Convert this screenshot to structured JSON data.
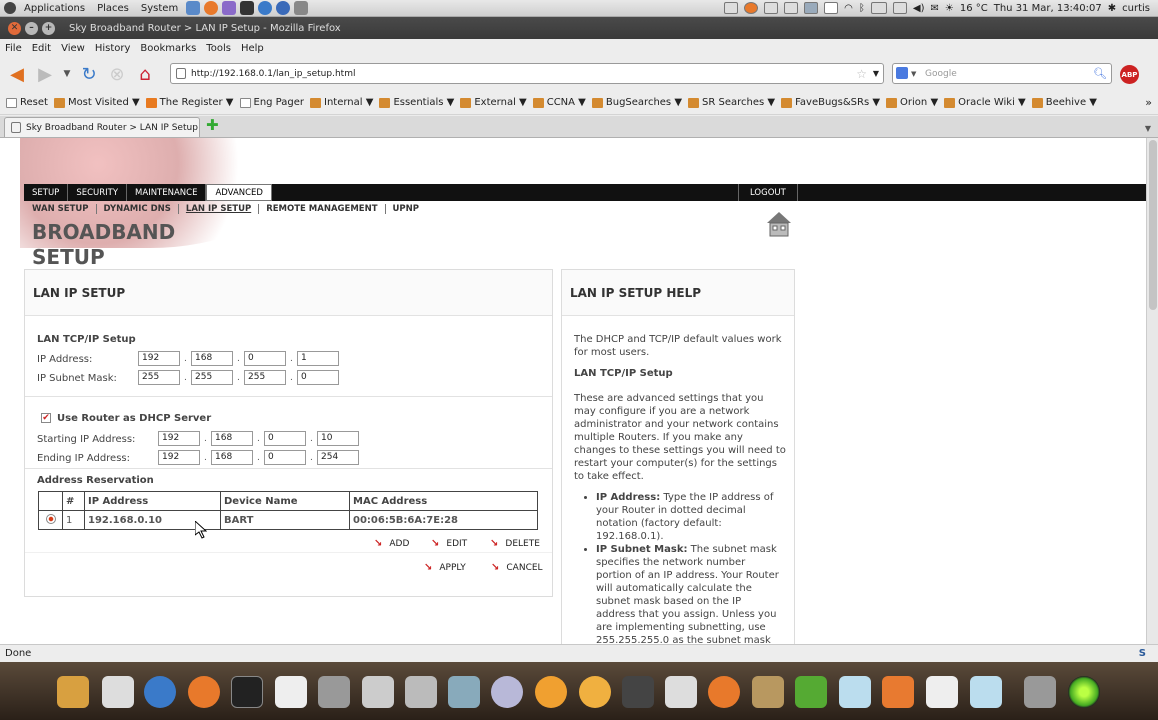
{
  "panel": {
    "menus": [
      "Applications",
      "Places",
      "System"
    ],
    "temperature": "16 °C",
    "datetime": "Thu 31 Mar, 13:40:07",
    "user": "curtis"
  },
  "window": {
    "title": "Sky Broadband Router > LAN IP Setup - Mozilla Firefox"
  },
  "menubar": [
    "File",
    "Edit",
    "View",
    "History",
    "Bookmarks",
    "Tools",
    "Help"
  ],
  "nav": {
    "url": "http://192.168.0.1/lan_ip_setup.html",
    "search_placeholder": "Google",
    "abp": "ABP"
  },
  "bookmarks": [
    "Reset",
    "Most Visited ▼",
    "The Register ▼",
    "Eng Pager",
    "Internal ▼",
    "Essentials ▼",
    "External ▼",
    "CCNA ▼",
    "BugSearches ▼",
    "SR Searches ▼",
    "FaveBugs&SRs ▼",
    "Orion ▼",
    "Oracle Wiki ▼",
    "Beehive ▼"
  ],
  "tab": {
    "label": "Sky Broadband Router > LAN IP Setup"
  },
  "router": {
    "mainnav": [
      "SETUP",
      "SECURITY",
      "MAINTENANCE",
      "ADVANCED"
    ],
    "logout": "LOGOUT",
    "subnav": [
      "WAN SETUP",
      "DYNAMIC DNS",
      "LAN IP SETUP",
      "REMOTE MANAGEMENT",
      "UPNP"
    ],
    "title_line1": "BROADBAND",
    "title_line2": "SETUP",
    "lan": {
      "heading": "LAN IP SETUP",
      "tcpip_title": "LAN TCP/IP Setup",
      "ip_label": "IP Address:",
      "ip": [
        "192",
        "168",
        "0",
        "1"
      ],
      "mask_label": "IP Subnet Mask:",
      "mask": [
        "255",
        "255",
        "255",
        "0"
      ],
      "dhcp_label": "Use Router as DHCP Server",
      "start_label": "Starting IP Address:",
      "start": [
        "192",
        "168",
        "0",
        "10"
      ],
      "end_label": "Ending IP Address:",
      "end": [
        "192",
        "168",
        "0",
        "254"
      ],
      "reservation_title": "Address Reservation",
      "columns": [
        "#",
        "IP Address",
        "Device Name",
        "MAC Address"
      ],
      "rows": [
        {
          "num": "1",
          "ip": "192.168.0.10",
          "device": "BART",
          "mac": "00:06:5B:6A:7E:28"
        }
      ],
      "add": "ADD",
      "edit": "EDIT",
      "delete": "DELETE",
      "apply": "APPLY",
      "cancel": "CANCEL"
    },
    "help": {
      "heading": "LAN IP SETUP HELP",
      "intro": "The DHCP and TCP/IP default values work for most users.",
      "sub": "LAN TCP/IP Setup",
      "para": "These are advanced settings that you may configure if you are a network administrator and your network contains multiple Routers. If you make any changes to these settings you will need to restart your computer(s) for the settings to take effect.",
      "b1_term": "IP Address:",
      "b1_text": "Type the IP address of your Router in dotted decimal notation (factory default: 192.168.0.1).",
      "b2_term": "IP Subnet Mask:",
      "b2_text": "The subnet mask specifies the network number portion of an IP address. Your Router will automatically calculate the subnet mask based on the IP address that you assign. Unless you are implementing subnetting, use 255.255.255.0 as the subnet mask"
    }
  },
  "status": "Done"
}
